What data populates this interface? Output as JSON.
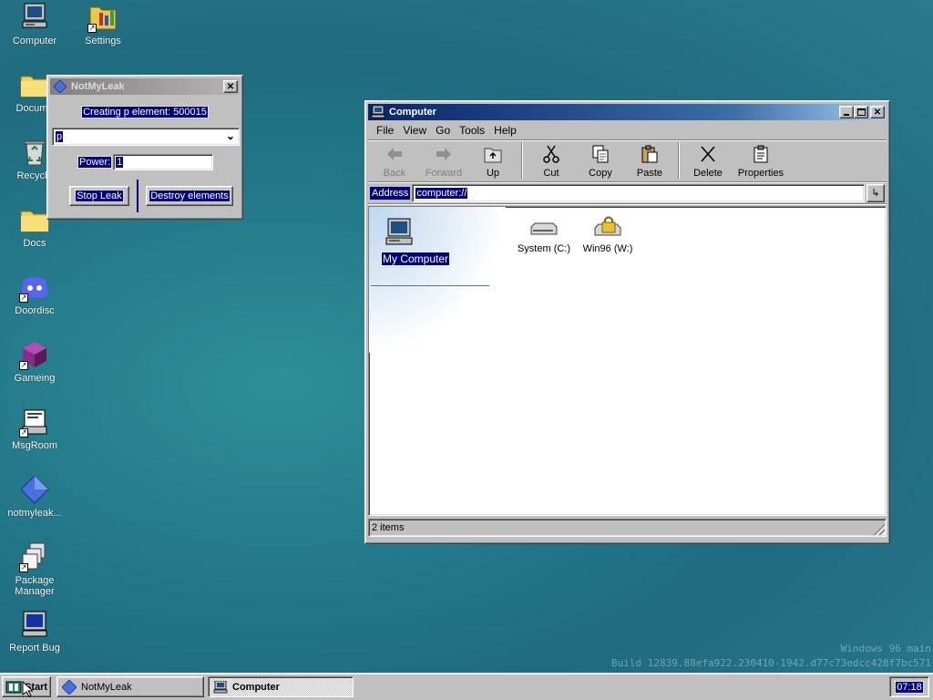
{
  "desktop": {
    "icons": [
      {
        "label": "Computer",
        "icon": "computer-icon"
      },
      {
        "label": "Settings",
        "icon": "settings-icon"
      },
      {
        "label": "Docume",
        "icon": "folder-icon"
      },
      {
        "label": "Recycle",
        "icon": "recycle-bin-icon"
      },
      {
        "label": "Docs",
        "icon": "folder-icon"
      },
      {
        "label": "Doordisc",
        "icon": "discord-icon"
      },
      {
        "label": "Gameing",
        "icon": "cube-icon"
      },
      {
        "label": "MsgRoom",
        "icon": "msgroom-icon"
      },
      {
        "label": "notmyleak...",
        "icon": "diamond-icon"
      },
      {
        "label": "Package Manager",
        "icon": "package-icon"
      },
      {
        "label": "Report Bug",
        "icon": "monitor-bug-icon"
      }
    ],
    "watermark_line1": "Windows 96 main",
    "watermark_line2": "Build 12839.88efa922.230410-1942.d77c73edcc428f7bc571"
  },
  "notmyleak": {
    "title": "NotMyLeak",
    "status": "Creating p element: 500015",
    "dropdown_value": "p",
    "power_label": "Power:",
    "power_value": "1",
    "stop_label": "Stop Leak",
    "destroy_label": "Destroy elements"
  },
  "explorer": {
    "title": "Computer",
    "menu": [
      "File",
      "View",
      "Go",
      "Tools",
      "Help"
    ],
    "toolbar": {
      "back": "Back",
      "forward": "Forward",
      "up": "Up",
      "cut": "Cut",
      "copy": "Copy",
      "paste": "Paste",
      "delete": "Delete",
      "properties": "Properties"
    },
    "address_label": "Address",
    "address_value": "computer://",
    "sidebar_title": "My Computer",
    "items": [
      {
        "label": "System (C:)",
        "icon": "drive-icon"
      },
      {
        "label": "Win96 (W:)",
        "icon": "locked-drive-icon"
      }
    ],
    "status": "2 items"
  },
  "taskbar": {
    "start_label": "Start",
    "tasks": [
      {
        "label": "NotMyLeak",
        "icon": "diamond-icon"
      },
      {
        "label": "Computer",
        "icon": "computer-icon"
      }
    ],
    "clock": "07:18"
  },
  "colors": {
    "selection": "#000080",
    "titlebar_active": "#0a246a",
    "face": "#c0c0c0"
  }
}
